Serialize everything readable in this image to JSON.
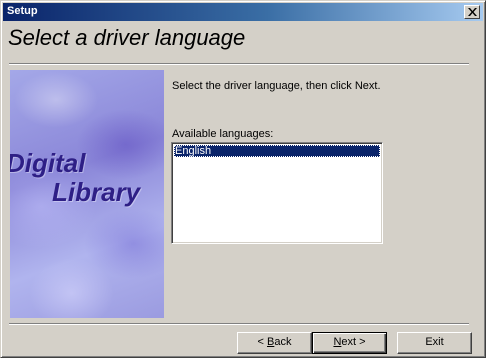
{
  "window": {
    "title": "Setup",
    "heading": "Select a driver language"
  },
  "side_panel": {
    "brand_line1": "Digital",
    "brand_line2": "Library",
    "colors": {
      "base": "#9b9be0",
      "text": "#2e1f86"
    }
  },
  "main": {
    "instruction": "Select the driver language, then click Next.",
    "languages_label": "Available languages:",
    "languages": [
      {
        "label": "English",
        "selected": true
      }
    ]
  },
  "buttons": {
    "back": {
      "prefix": "< ",
      "mnemonic": "B",
      "rest": "ack"
    },
    "next": {
      "mnemonic": "N",
      "rest": "ext >"
    },
    "exit": "Exit"
  },
  "icons": {
    "close": "close-icon"
  },
  "colors": {
    "titlebar_start": "#0a246a",
    "titlebar_end": "#a6caf0",
    "selection": "#0a246a",
    "face": "#d4d0c8"
  }
}
